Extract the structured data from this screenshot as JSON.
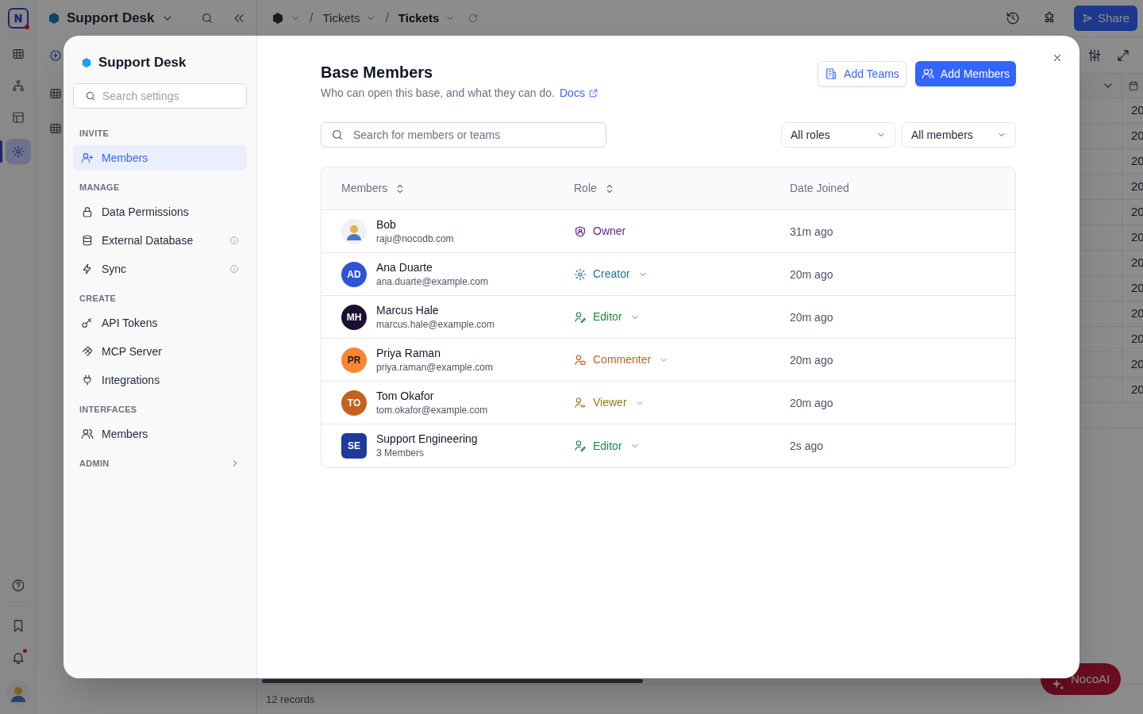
{
  "app": {
    "base_name": "Support Desk",
    "breadcrumb": [
      {
        "separator": "/",
        "label": "Tickets",
        "current": false
      },
      {
        "separator": "/",
        "label": "Tickets",
        "current": true
      }
    ],
    "share_button": "Share",
    "grid_cells": [
      "20",
      "20",
      "20",
      "20",
      "20",
      "20",
      "20",
      "20",
      "20",
      "20",
      "20",
      "20"
    ],
    "records": "12 records",
    "ai_button": "NocoAI",
    "notification_unread": true
  },
  "modal": {
    "sidebar": {
      "title": "Support Desk",
      "search_placeholder": "Search settings",
      "sections": [
        {
          "heading": "INVITE",
          "expanded": true,
          "items": [
            {
              "label": "Members",
              "kind": "invite",
              "selected": true,
              "info": false
            }
          ]
        },
        {
          "heading": "MANAGE",
          "expanded": true,
          "items": [
            {
              "label": "Data Permissions",
              "kind": "permissions",
              "selected": false,
              "info": false
            },
            {
              "label": "External Database",
              "kind": "database",
              "selected": false,
              "info": true
            },
            {
              "label": "Sync",
              "kind": "sync",
              "selected": false,
              "info": true
            }
          ]
        },
        {
          "heading": "CREATE",
          "expanded": true,
          "items": [
            {
              "label": "API Tokens",
              "kind": "tokens",
              "selected": false,
              "info": false
            },
            {
              "label": "MCP Server",
              "kind": "mcp",
              "selected": false,
              "info": false
            },
            {
              "label": "Integrations",
              "kind": "integrations",
              "selected": false,
              "info": false
            }
          ]
        },
        {
          "heading": "INTERFACES",
          "expanded": true,
          "items": [
            {
              "label": "Members",
              "kind": "members",
              "selected": false,
              "info": false
            }
          ]
        },
        {
          "heading": "ADMIN",
          "expanded": false
        }
      ]
    },
    "title": "Base Members",
    "subtitle": "Who can open this base, and what they can do.",
    "docs_link": "Docs",
    "add_teams": "Add Teams",
    "add_members": "Add Members",
    "search_placeholder": "Search for members or teams",
    "filters": [
      "All roles",
      "All members"
    ],
    "columns": [
      {
        "label": "Members",
        "sortable": true
      },
      {
        "label": "Role",
        "sortable": true
      },
      {
        "label": "Date Joined",
        "sortable": false
      }
    ],
    "rows": [
      {
        "kind": "user",
        "name": "Bob",
        "detail": "raju@nocodb.com",
        "role": {
          "label": "Owner",
          "kind": "owner",
          "color": "#5b1f8f",
          "dropdown": false
        },
        "joined": "31m ago"
      },
      {
        "kind": "user",
        "initials": "AD",
        "color": "#2f55d4",
        "name": "Ana Duarte",
        "detail": "ana.duarte@example.com",
        "role": {
          "label": "Creator",
          "kind": "creator",
          "color": "#1f6f99",
          "dropdown": true
        },
        "joined": "20m ago"
      },
      {
        "kind": "user",
        "initials": "MH",
        "color": "#1a0f2e",
        "name": "Marcus Hale",
        "detail": "marcus.hale@example.com",
        "role": {
          "label": "Editor",
          "kind": "editor",
          "color": "#1e8a3e",
          "dropdown": true
        },
        "joined": "20m ago"
      },
      {
        "kind": "user",
        "initials": "PR",
        "color": "#fb8532",
        "name": "Priya Raman",
        "detail": "priya.raman@example.com",
        "role": {
          "label": "Commenter",
          "kind": "commenter",
          "color": "#c2621b",
          "dropdown": true
        },
        "joined": "20m ago"
      },
      {
        "kind": "user",
        "initials": "TO",
        "color": "#c7601f",
        "name": "Tom Okafor",
        "detail": "tom.okafor@example.com",
        "role": {
          "label": "Viewer",
          "kind": "viewer",
          "color": "#9a7418",
          "dropdown": true
        },
        "joined": "20m ago"
      },
      {
        "kind": "team",
        "initials": "SE",
        "color": "#1e3a9a",
        "name": "Support Engineering",
        "detail": "3 Members",
        "role": {
          "label": "Editor",
          "kind": "editor",
          "color": "#1e8a3e",
          "dropdown": true
        },
        "joined": "2s ago"
      }
    ]
  }
}
